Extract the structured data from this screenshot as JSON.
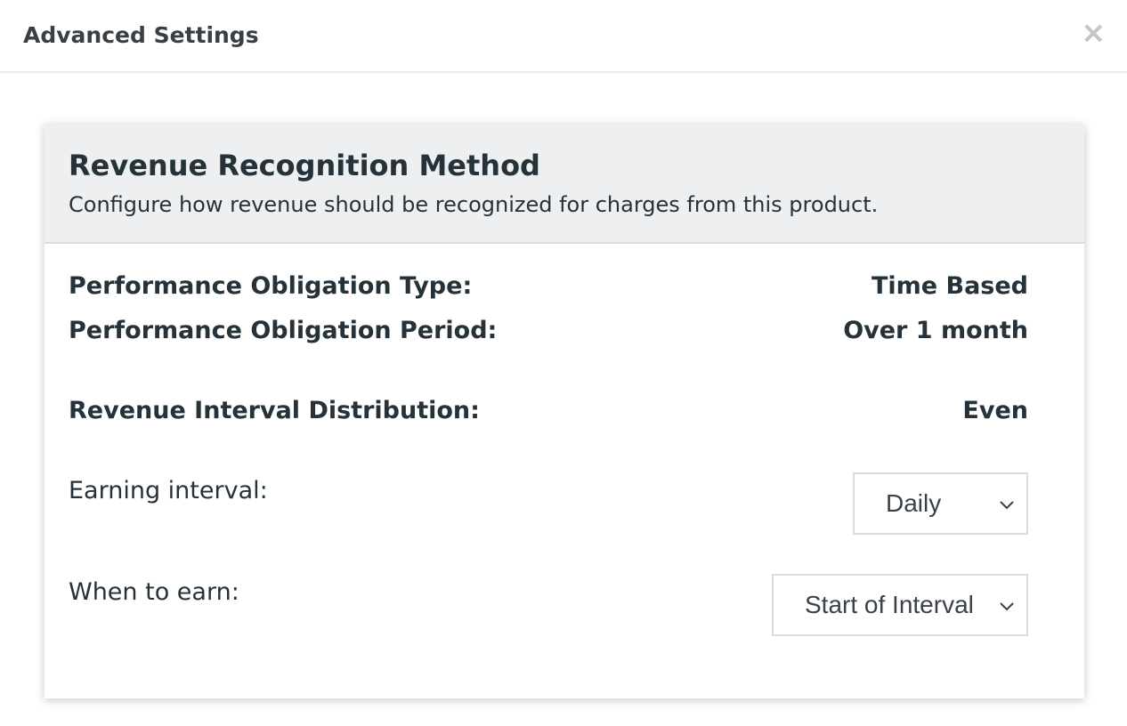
{
  "dialog": {
    "title": "Advanced Settings",
    "close_glyph": "×"
  },
  "card": {
    "title": "Revenue Recognition Method",
    "subtitle": "Configure how revenue should be recognized for charges from this product.",
    "rows": [
      {
        "label": "Performance Obligation Type:",
        "value": "Time Based"
      },
      {
        "label": "Performance Obligation Period:",
        "value": "Over 1 month"
      },
      {
        "label": "Revenue Interval Distribution:",
        "value": "Even"
      }
    ],
    "earning_interval": {
      "label": "Earning interval:",
      "selected": "Daily"
    },
    "when_to_earn": {
      "label": "When to earn:",
      "selected": "Start of Interval"
    }
  },
  "icons": {
    "close": "close-icon",
    "dropdown": "chevron-down-icon"
  },
  "colors": {
    "text": "#26323a",
    "header_bg": "#eeeff0",
    "border": "#d5dde1",
    "close": "#c4c7ca"
  }
}
